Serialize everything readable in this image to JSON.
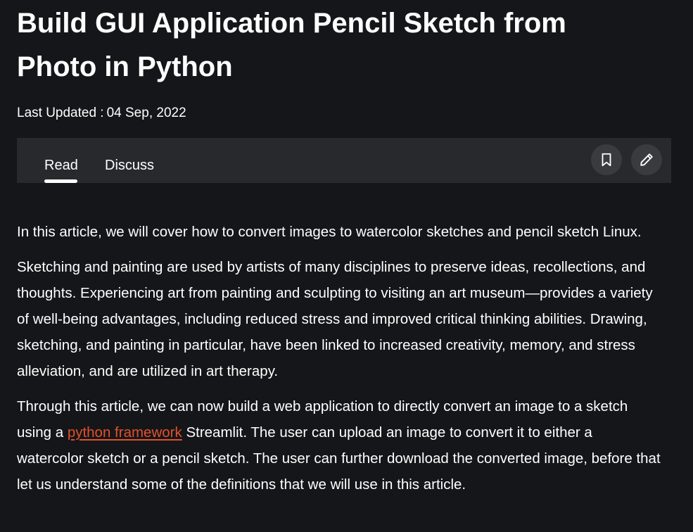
{
  "article": {
    "title": "Build GUI Application Pencil Sketch from Photo in Python",
    "updated_label": "Last Updated :",
    "updated_date": "04 Sep, 2022"
  },
  "tabs": [
    {
      "label": "Read",
      "active": true
    },
    {
      "label": "Discuss",
      "active": false
    }
  ],
  "actions": {
    "bookmark_icon": "bookmark-icon",
    "edit_icon": "pencil-icon"
  },
  "body": {
    "p1": "In this article, we will cover how to convert images to watercolor sketches and pencil sketch Linux.",
    "p2": "Sketching and painting are used by artists of many disciplines to preserve ideas, recollections, and thoughts. Experiencing art from painting and sculpting to visiting an art museum—provides a variety of well-being advantages, including reduced stress and improved critical thinking abilities. Drawing, sketching, and painting in particular, have been linked to increased creativity, memory, and stress alleviation, and are utilized in art therapy.",
    "p3_before": "Through this article, we can now build a web application to directly convert an image to a sketch using a ",
    "p3_link": "python framework",
    "p3_after": " Streamlit. The user can upload an image to convert it to either a watercolor sketch or a pencil sketch. The user can further download the converted image, before that let us understand some of the definitions that we will use in this article."
  },
  "colors": {
    "background": "#151619",
    "tabbar": "#28292c",
    "icon_button": "#3a3b3f",
    "link": "#e2512b",
    "text": "#ffffff"
  }
}
